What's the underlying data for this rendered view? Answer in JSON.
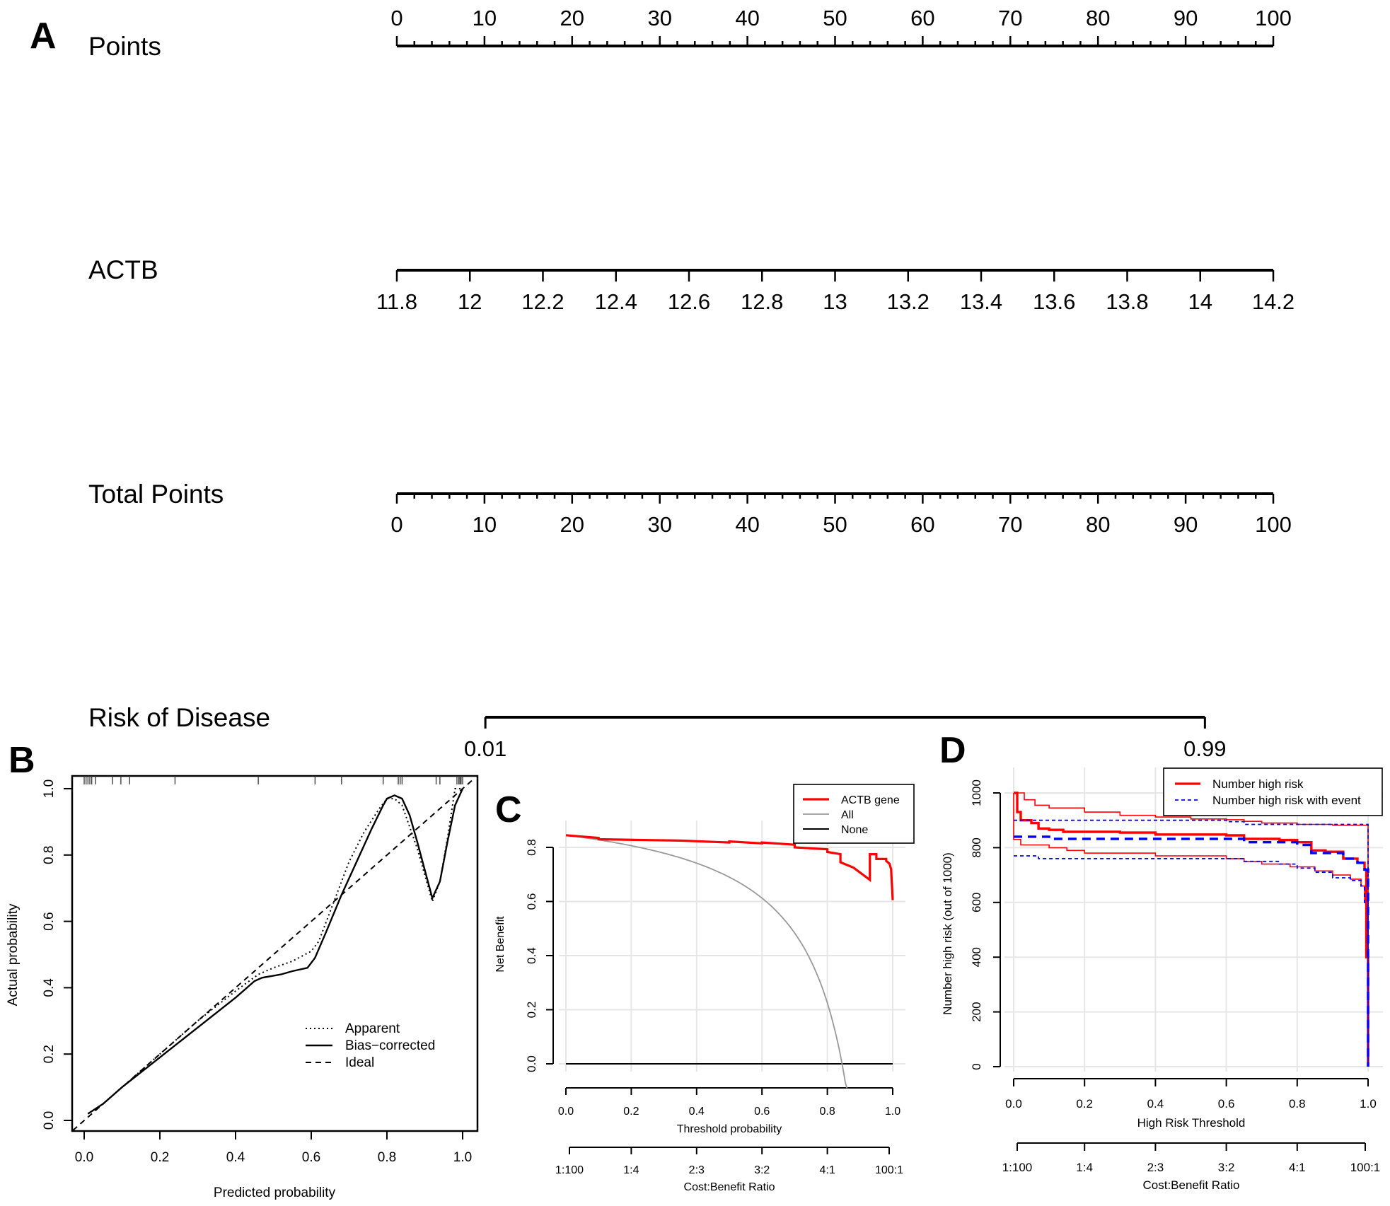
{
  "figure": {
    "panel_labels": {
      "A": "A",
      "B": "B",
      "C": "C",
      "D": "D"
    }
  },
  "chart_data": [
    {
      "panel": "A",
      "type": "nomogram",
      "rows": [
        {
          "name": "Points",
          "range": [
            0,
            100
          ],
          "ticks": [
            0,
            10,
            20,
            30,
            40,
            50,
            60,
            70,
            80,
            90,
            100
          ],
          "tick_labels": [
            "0",
            "10",
            "20",
            "30",
            "40",
            "50",
            "60",
            "70",
            "80",
            "90",
            "100"
          ],
          "minor_step": 2
        },
        {
          "name": "ACTB",
          "range": [
            11.8,
            14.2
          ],
          "ticks": [
            11.8,
            12,
            12.2,
            12.4,
            12.6,
            12.8,
            13,
            13.2,
            13.4,
            13.6,
            13.8,
            14,
            14.2
          ],
          "tick_labels": [
            "11.8",
            "12",
            "12.2",
            "12.4",
            "12.6",
            "12.8",
            "13",
            "13.2",
            "13.4",
            "13.6",
            "13.8",
            "14",
            "14.2"
          ]
        },
        {
          "name": "Total Points",
          "range": [
            0,
            100
          ],
          "ticks": [
            0,
            10,
            20,
            30,
            40,
            50,
            60,
            70,
            80,
            90,
            100
          ],
          "tick_labels": [
            "0",
            "10",
            "20",
            "30",
            "40",
            "50",
            "60",
            "70",
            "80",
            "90",
            "100"
          ],
          "minor_step": 2
        },
        {
          "name": "Risk of Disease",
          "range_points": [
            10.1,
            92.2
          ],
          "ticks": [
            0.01,
            0.99
          ],
          "tick_labels": [
            "0.01",
            "0.99"
          ]
        }
      ]
    },
    {
      "panel": "B",
      "type": "line",
      "title": "",
      "xlabel": "Predicted probability",
      "ylabel": "Actual probability",
      "xlim": [
        -0.03,
        1.03
      ],
      "ylim": [
        -0.03,
        1.04
      ],
      "xticks": [
        0.0,
        0.2,
        0.4,
        0.6,
        0.8,
        1.0
      ],
      "xtick_labels": [
        "0.0",
        "0.2",
        "0.4",
        "0.6",
        "0.8",
        "1.0"
      ],
      "yticks": [
        0.0,
        0.2,
        0.4,
        0.6,
        0.8,
        1.0
      ],
      "ytick_labels": [
        "0.0",
        "0.2",
        "0.4",
        "0.6",
        "0.8",
        "1.0"
      ],
      "grid": false,
      "legend_position": "bottom-right",
      "rug": [
        0.0,
        0.005,
        0.01,
        0.015,
        0.02,
        0.03,
        0.075,
        0.097,
        0.12,
        0.24,
        0.46,
        0.61,
        0.68,
        0.79,
        0.83,
        0.835,
        0.84,
        0.93,
        0.94,
        0.985,
        0.99,
        0.993,
        0.996,
        1.0
      ],
      "series": [
        {
          "name": "Apparent",
          "style": "dotted",
          "x": [
            0.01,
            0.05,
            0.1,
            0.2,
            0.3,
            0.4,
            0.46,
            0.5,
            0.55,
            0.6,
            0.62,
            0.66,
            0.7,
            0.74,
            0.78,
            0.8,
            0.82,
            0.84,
            0.88,
            0.92,
            0.94,
            0.96,
            0.98,
            1.0
          ],
          "y": [
            0.02,
            0.05,
            0.1,
            0.2,
            0.3,
            0.39,
            0.44,
            0.46,
            0.48,
            0.51,
            0.54,
            0.66,
            0.78,
            0.87,
            0.94,
            0.97,
            0.97,
            0.95,
            0.82,
            0.66,
            0.72,
            0.85,
            1.0,
            1.0
          ]
        },
        {
          "name": "Bias-corrected",
          "style": "solid",
          "x": [
            0.01,
            0.05,
            0.1,
            0.2,
            0.3,
            0.4,
            0.45,
            0.47,
            0.52,
            0.55,
            0.59,
            0.61,
            0.64,
            0.68,
            0.72,
            0.76,
            0.79,
            0.8,
            0.82,
            0.84,
            0.86,
            0.88,
            0.92,
            0.94,
            0.96,
            0.98,
            1.0
          ],
          "y": [
            0.02,
            0.05,
            0.1,
            0.19,
            0.28,
            0.37,
            0.42,
            0.43,
            0.44,
            0.45,
            0.46,
            0.49,
            0.57,
            0.68,
            0.78,
            0.88,
            0.95,
            0.97,
            0.98,
            0.97,
            0.92,
            0.84,
            0.67,
            0.72,
            0.84,
            0.95,
            1.0
          ]
        },
        {
          "name": "Ideal",
          "style": "dashed",
          "x": [
            -0.03,
            1.03
          ],
          "y": [
            -0.03,
            1.03
          ]
        }
      ]
    },
    {
      "panel": "C",
      "type": "line",
      "xlabel": "Threshold probability",
      "ylabel": "Net Benefit",
      "x2label": "Cost:Benefit Ratio",
      "xlim": [
        0,
        1
      ],
      "ylim": [
        -0.09,
        0.9
      ],
      "xticks": [
        0.0,
        0.2,
        0.4,
        0.6,
        0.8,
        1.0
      ],
      "xtick_labels": [
        "0.0",
        "0.2",
        "0.4",
        "0.6",
        "0.8",
        "1.0"
      ],
      "x2tick_labels": [
        "1:100",
        "1:4",
        "2:3",
        "3:2",
        "4:1",
        "100:1"
      ],
      "yticks": [
        0.0,
        0.2,
        0.4,
        0.6,
        0.8
      ],
      "ytick_labels": [
        "0.0",
        "0.2",
        "0.4",
        "0.6",
        "0.8"
      ],
      "grid": true,
      "legend_position": "top-right",
      "series": [
        {
          "name": "ACTB gene",
          "color": "#ff0000",
          "x": [
            0.0,
            0.1,
            0.1,
            0.25,
            0.35,
            0.5,
            0.5,
            0.6,
            0.6,
            0.7,
            0.7,
            0.8,
            0.8,
            0.84,
            0.84,
            0.88,
            0.93,
            0.93,
            0.95,
            0.95,
            0.98,
            0.98,
            0.99,
            0.995,
            1.0
          ],
          "y": [
            0.845,
            0.835,
            0.83,
            0.827,
            0.825,
            0.818,
            0.822,
            0.815,
            0.818,
            0.81,
            0.8,
            0.793,
            0.783,
            0.775,
            0.745,
            0.725,
            0.68,
            0.775,
            0.775,
            0.757,
            0.757,
            0.75,
            0.74,
            0.72,
            0.605
          ]
        },
        {
          "name": "All",
          "color": "#999999",
          "x": "prevalence 0.845 curve: y = p - (1-p)*t/(1-t)"
        },
        {
          "name": "None",
          "color": "#000000",
          "x": [
            0,
            1
          ],
          "y": [
            0,
            0
          ]
        }
      ],
      "all_prevalence": 0.845
    },
    {
      "panel": "D",
      "type": "line",
      "xlabel": "High Risk Threshold",
      "ylabel": "Number high risk (out of 1000)",
      "x2label": "Cost:Benefit Ratio",
      "xlim": [
        0,
        1
      ],
      "ylim": [
        0,
        1000
      ],
      "xticks": [
        0.0,
        0.2,
        0.4,
        0.6,
        0.8,
        1.0
      ],
      "xtick_labels": [
        "0.0",
        "0.2",
        "0.4",
        "0.6",
        "0.8",
        "1.0"
      ],
      "x2tick_labels": [
        "1:100",
        "1:4",
        "2:3",
        "3:2",
        "4:1",
        "100:1"
      ],
      "yticks": [
        0,
        200,
        400,
        600,
        800,
        1000
      ],
      "ytick_labels": [
        "0",
        "200",
        "400",
        "600",
        "800",
        "1000"
      ],
      "grid": true,
      "legend_position": "top-right",
      "series": [
        {
          "name": "Number high risk",
          "color": "#ff0000",
          "style": "solid-thick",
          "x": [
            0.0,
            0.01,
            0.02,
            0.05,
            0.07,
            0.1,
            0.14,
            0.3,
            0.4,
            0.6,
            0.65,
            0.75,
            0.8,
            0.84,
            0.88,
            0.93,
            0.97,
            0.99,
            0.995,
            1.0
          ],
          "y": [
            1000,
            930,
            900,
            890,
            870,
            865,
            858,
            855,
            848,
            845,
            832,
            828,
            820,
            790,
            785,
            760,
            745,
            720,
            400,
            0
          ]
        },
        {
          "name": "Number high risk (upper CI)",
          "color": "#ff0000",
          "style": "solid-thin",
          "x": [
            0.0,
            0.03,
            0.06,
            0.1,
            0.2,
            0.3,
            0.4,
            0.5,
            0.6,
            0.65,
            0.7,
            0.8,
            0.9,
            1.0,
            1.0
          ],
          "y": [
            1000,
            975,
            955,
            945,
            930,
            918,
            912,
            905,
            902,
            896,
            890,
            885,
            882,
            880,
            0
          ]
        },
        {
          "name": "Number high risk (lower CI)",
          "color": "#ff0000",
          "style": "solid-thin",
          "x": [
            0.0,
            0.0,
            0.02,
            0.1,
            0.15,
            0.2,
            0.4,
            0.6,
            0.65,
            0.7,
            0.78,
            0.85,
            0.9,
            0.95,
            0.98,
            0.99,
            1.0
          ],
          "y": [
            1000,
            830,
            810,
            800,
            790,
            780,
            770,
            760,
            750,
            740,
            730,
            715,
            700,
            685,
            660,
            600,
            0
          ]
        },
        {
          "name": "Number high risk with event",
          "color": "#0000ff",
          "style": "dashed-thick",
          "x": [
            0.0,
            0.1,
            0.1,
            0.6,
            0.65,
            0.8,
            0.84,
            0.93,
            0.97,
            0.99,
            1.0
          ],
          "y": [
            840,
            840,
            832,
            832,
            820,
            810,
            780,
            760,
            745,
            720,
            0
          ]
        },
        {
          "name": "Number high risk with event (upper CI)",
          "color": "#0000ff",
          "style": "dotted",
          "x": [
            0.0,
            0.5,
            0.6,
            0.65,
            1.0,
            1.0
          ],
          "y": [
            900,
            900,
            895,
            885,
            880,
            0
          ]
        },
        {
          "name": "Number high risk with event (lower CI)",
          "color": "#0000ff",
          "style": "dotted",
          "x": [
            0.0,
            0.07,
            0.6,
            0.65,
            0.75,
            0.8,
            0.85,
            0.9,
            0.95,
            0.98,
            0.99,
            1.0
          ],
          "y": [
            770,
            760,
            760,
            750,
            740,
            725,
            710,
            690,
            680,
            660,
            600,
            0
          ]
        }
      ]
    }
  ],
  "text": {
    "A_label": "A",
    "B_label": "B",
    "C_label": "C",
    "D_label": "D",
    "nomo_points": "Points",
    "nomo_actb": "ACTB",
    "nomo_total": "Total Points",
    "nomo_risk": "Risk of Disease",
    "B_legend": [
      "Apparent",
      "Bias−corrected",
      "Ideal"
    ],
    "C_legend": [
      "ACTB gene",
      "All",
      "None"
    ],
    "D_legend": [
      "Number high risk",
      "Number high risk with event"
    ]
  }
}
